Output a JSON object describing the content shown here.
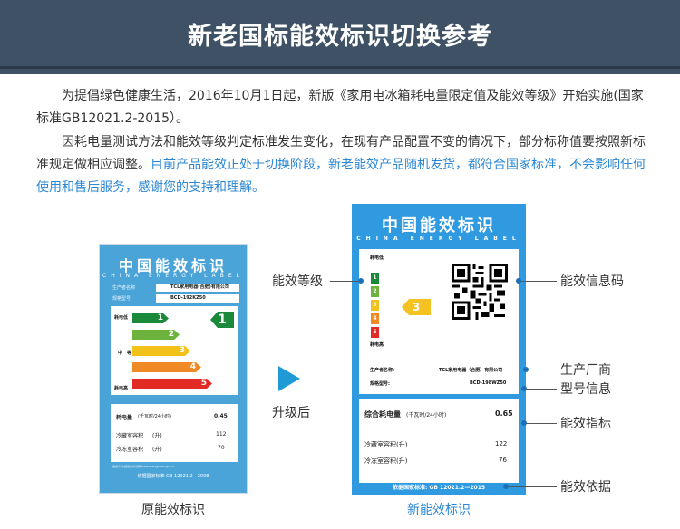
{
  "banner": {
    "title": "新老国标能效标识切换参考"
  },
  "paragraph1": {
    "text": "为提倡绿色健康生活，2016年10月1日起，新版《家用电冰箱耗电量限定值及能效等级》开始实施(国家标准GB12021.2-2015）。"
  },
  "paragraph2": {
    "text_normal": "因耗电量测试方法和能效等级判定标准发生变化，在现有产品配置不变的情况下，部分标称值要按照新标准规定做相应调整。",
    "text_highlight": "目前产品能效正处于切换阶段，新老能效产品随机发货，都符合国家标准，不会影响任何使用和售后服务，感谢您的支持和理解。"
  },
  "colors": {
    "banner": "#3f5165",
    "highlight": "#2b87d3",
    "label_blue": "#2f9ae0",
    "arrow": "#1f9ad6"
  },
  "old_label": {
    "title": "中国能效标识",
    "subtitle": "CHINA ENERGY LABEL",
    "manufacturer_key": "生产者名称",
    "manufacturer_val": "TCL家用电器(合肥)有限公司",
    "model_key": "规格型号",
    "model_val": "BCD-192KZ50",
    "low_label": "耗电低",
    "mid_label": "中　等",
    "high_label": "耗电高",
    "grades": [
      "1",
      "2",
      "3",
      "4",
      "5"
    ],
    "current_grade": "1",
    "consumption_label": "耗电量",
    "consumption_unit": "(千瓦时/24小时)",
    "consumption_val": "0.45",
    "fridge_label": "冷藏室容积",
    "fridge_unit": "(升)",
    "fridge_val": "112",
    "freezer_label": "冷冻室容积",
    "freezer_unit": "(升)",
    "freezer_val": "70",
    "small_text": "备案号 中国能效标识网 www.energylabel.gov.cn",
    "footer": "依据国家标准  GB 12021.2—2008",
    "caption": "原能效标识"
  },
  "transition": {
    "label": "升级后"
  },
  "new_label": {
    "title": "中国能效标识",
    "subtitle": "CHINA ENERGY LABEL",
    "low_label": "耗电低",
    "high_label": "耗电高",
    "grades": [
      "1",
      "2",
      "3",
      "4",
      "5"
    ],
    "current_grade": "3",
    "manufacturer_key": "生产者名称:",
    "manufacturer_val": "TCL家用电器（合肥）有限公司",
    "model_key": "规格型号:",
    "model_val": "BCD-198WZ50",
    "consumption_label": "综合耗电量",
    "consumption_unit": "(千瓦时/24小时)",
    "consumption_val": "0.65",
    "fridge_label": "冷藏室容积(升)",
    "fridge_val": "122",
    "freezer_label": "冷冻室容积(升)",
    "freezer_val": "76",
    "footer": "依据国家标准: GB 12021.2—2015",
    "caption": "新能效标识"
  },
  "callouts": {
    "grade": "能效等级",
    "qr": "能效信息码",
    "manufacturer": "生产厂商",
    "model": "型号信息",
    "metrics": "能效指标",
    "basis": "能效依据"
  }
}
